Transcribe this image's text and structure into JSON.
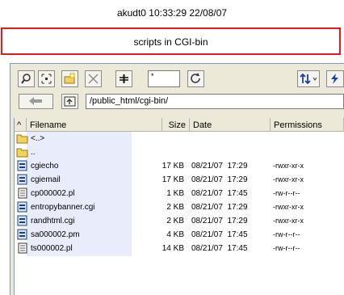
{
  "top_status": "akudt0 10:33:29 22/08/07",
  "banner": "scripts in CGI-bin",
  "toolbar": {
    "input_value": "*",
    "buttons": [
      "find-icon",
      "select-all-icon",
      "new-folder-icon",
      "delete-icon",
      "plus-icon",
      "refresh-icon",
      "sort-icon",
      "lightning-icon"
    ]
  },
  "path": "/public_html/cgi-bin/",
  "columns": {
    "up": "^",
    "filename": "Filename",
    "size": "Size",
    "date": "Date",
    "permissions": "Permissions"
  },
  "rows": [
    {
      "name": "<..>",
      "size": "",
      "date": "",
      "perms": "",
      "icon": "folder-icon"
    },
    {
      "name": "..",
      "size": "",
      "date": "",
      "perms": "",
      "icon": "folder-icon"
    },
    {
      "name": "cgiecho",
      "size": "17 KB",
      "date": "08/21/07  17:29",
      "perms": "-rwxr-xr-x",
      "icon": "file-icon"
    },
    {
      "name": "cgiemail",
      "size": "17 KB",
      "date": "08/21/07  17:29",
      "perms": "-rwxr-xr-x",
      "icon": "file-icon"
    },
    {
      "name": "cp000002.pl",
      "size": "1 KB",
      "date": "08/21/07  17:45",
      "perms": "-rw-r--r--",
      "icon": "text-file-icon"
    },
    {
      "name": "entropybanner.cgi",
      "size": "2 KB",
      "date": "08/21/07  17:29",
      "perms": "-rwxr-xr-x",
      "icon": "file-icon"
    },
    {
      "name": "randhtml.cgi",
      "size": "2 KB",
      "date": "08/21/07  17:29",
      "perms": "-rwxr-xr-x",
      "icon": "file-icon"
    },
    {
      "name": "sa000002.pm",
      "size": "4 KB",
      "date": "08/21/07  17:45",
      "perms": "-rw-r--r--",
      "icon": "file-icon"
    },
    {
      "name": "ts000002.pl",
      "size": "14 KB",
      "date": "08/21/07  17:45",
      "perms": "-rw-r--r--",
      "icon": "text-file-icon"
    }
  ]
}
